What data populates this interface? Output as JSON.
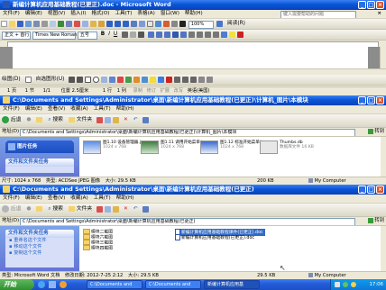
{
  "word": {
    "title": "新编计算机应用基础教程(已更正).doc - Microsoft Word",
    "menu": [
      "文件(F)",
      "编辑(E)",
      "视图(V)",
      "插入(I)",
      "格式(O)",
      "工具(T)",
      "表格(A)",
      "窗口(W)",
      "帮助(H)"
    ],
    "help_placeholder": "键入需要帮助的问题",
    "zoom": "100%",
    "read_label": "阅读(R)",
    "style": "正文 + 首行",
    "font": "Times New Roman",
    "size": "五号",
    "draw_label": "绘图(D)",
    "autoshapes_label": "自选图形(U)",
    "status": {
      "page": "1 页",
      "section": "1 节",
      "pages": "1/1",
      "position": "位置 2.5厘米",
      "line": "1 行",
      "column": "1 列",
      "rec": "录制",
      "trk": "修订",
      "ext": "扩展",
      "ovr": "改写",
      "lang": "英语(美国)"
    }
  },
  "explorer1": {
    "title": "C:\\Documents and Settings\\Administrator\\桌面\\新编计算机应用基础教程(已更正)\\计算机_图片\\本模块",
    "menu": [
      "文件(F)",
      "编辑(E)",
      "查看(V)",
      "收藏(A)",
      "工具(T)",
      "帮助(H)"
    ],
    "back": "后退",
    "search": "搜索",
    "folders": "文件夹",
    "address_label": "地址(D)",
    "address": "C:\\Documents and Settings\\Administrator\\桌面\\新编计算机应用基础教程(已更正)\\计算机_图片\\本模块",
    "go": "转到",
    "pane1": "图片任务",
    "pane2": "文件和文件夹任务",
    "thumbs": [
      {
        "name": "图1.10 设备管理器.jpg",
        "size": "1024 x 768",
        "type": "ACDSee JPEG 图像"
      },
      {
        "name": "图1.11 调用开始菜单.jpg",
        "size": "1024 x 768",
        "type": "ACDSee JPEG 图像"
      },
      {
        "name": "图1.12 标准开始菜单.jpg",
        "size": "1024 x 768",
        "type": "ACDSee JPEG 图像"
      },
      {
        "name": "Thumbs.db",
        "size": "",
        "type": "数据库文件 16 KB"
      }
    ],
    "status": {
      "dims": "尺寸: 1024 x 768",
      "type": "类型: ACDSee JPEG 图像",
      "size": "大小: 29.5 KB",
      "right_size": "200 KB",
      "computer": "My Computer"
    }
  },
  "explorer2": {
    "title": "C:\\Documents and Settings\\Administrator\\桌面\\新编计算机应用基础教程(已更正)",
    "menu": [
      "文件(F)",
      "编辑(E)",
      "查看(V)",
      "收藏(A)",
      "工具(T)",
      "帮助(H)"
    ],
    "back": "后退",
    "search": "搜索",
    "folders": "文件夹",
    "address_label": "地址(D)",
    "address": "C:\\Documents and Settings\\Administrator\\桌面\\新编计算机应用基础教程(已更正)",
    "go": "转到",
    "pane_title": "文件和文件夹任务",
    "links": [
      "重命名这个文件",
      "移动这个文件",
      "复制这个文件"
    ],
    "folders_list": [
      "模块二截图",
      "模块六截图",
      "模块三截图",
      "模块四截图"
    ],
    "files": [
      "新编计算机应用基础教程课件(已更正).doc",
      "新编计算机应用基础教程(已更正).doc"
    ],
    "status": {
      "type": "类型: Microsoft Word 文档",
      "modified": "修改日期: 2012-7-25 2:12",
      "size": "大小: 29.5 KB",
      "right_size": "29.5 KB",
      "computer": "My Computer"
    }
  },
  "taskbar": {
    "start": "开始",
    "tasks": [
      "C:\\Documents and",
      "C:\\Documents and",
      "新编计算机应用基"
    ],
    "time": "17:06"
  }
}
